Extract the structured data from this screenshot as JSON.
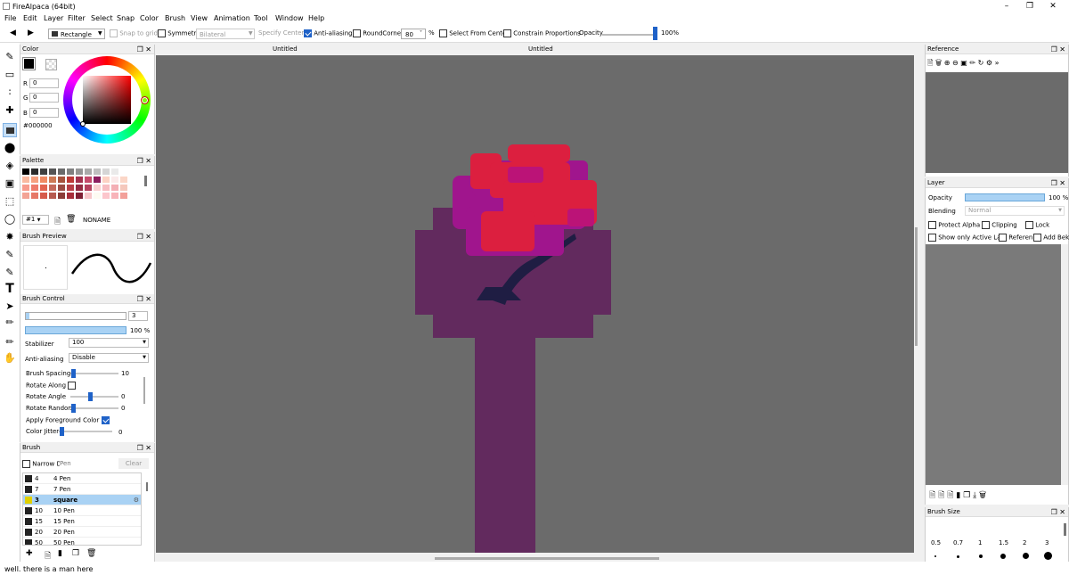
{
  "app": {
    "title": "FireAlpaca (64bit)"
  },
  "menu": [
    "File",
    "Edit",
    "Layer",
    "Filter",
    "Select",
    "Snap",
    "Color",
    "Brush",
    "View",
    "Animation",
    "Tool",
    "Window",
    "Help"
  ],
  "toolbar": {
    "tool_select": "Rectangle",
    "snap": "Snap to grid",
    "symmetry": "Symmetry",
    "symmetry_mode": "Bilateral",
    "specify_center": "Specify Center",
    "antialias": "Anti-aliasing",
    "roundcorner": "RoundCorner",
    "roundcorner_value": "80",
    "percent": "%",
    "select_center": "Select From Center",
    "constrain": "Constrain Proportions",
    "opacity": "Opacity",
    "opacity_value": "100%"
  },
  "docs": {
    "tab1": "Untitled",
    "tab2": "Untitled"
  },
  "color_panel": {
    "title": "Color",
    "r_label": "R",
    "r": "0",
    "g_label": "G",
    "g": "0",
    "b_label": "B",
    "b": "0",
    "hex": "#000000",
    "fg": "#000000"
  },
  "palette_panel": {
    "title": "Palette",
    "selector": "#1",
    "name": "NONAME",
    "rows": [
      [
        "#000000",
        "#2b2b2b",
        "#404040",
        "#555555",
        "#6a6a6a",
        "#808080",
        "#959595",
        "#aaaaaa",
        "#c0c0c0",
        "#d5d5d5",
        "#eaeaea",
        "#ffffff"
      ],
      [
        "#f9b9a0",
        "#f6a07f",
        "#f08a63",
        "#cd7a55",
        "#a6533d",
        "#bb3a36",
        "#a2304d",
        "#c44a6b",
        "#8c1d5e",
        "#fcd2c4",
        "#fbeaea",
        "#fbd6c7"
      ],
      [
        "#f79b8d",
        "#ee7b6b",
        "#e2634f",
        "#c46a5b",
        "#9b4b43",
        "#b73f47",
        "#932b42",
        "#b5405e",
        "#fad0d0",
        "#f7bcc1",
        "#f4aeb5",
        "#f5c8bc"
      ],
      [
        "#f3a395",
        "#e67867",
        "#d65a4b",
        "#b75b50",
        "#8b3d38",
        "#a62e3a",
        "#7e2034",
        "#f7c6c9",
        "#fdfbf2",
        "#fcc6cc",
        "#f8b3b9",
        "#f3a09a"
      ]
    ]
  },
  "brush_preview": {
    "title": "Brush Preview"
  },
  "brush_control": {
    "title": "Brush Control",
    "size": "3",
    "opacity": "100 %",
    "stabilizer_label": "Stabilizer",
    "stabilizer": "100",
    "antialias_label": "Anti-aliasing",
    "antialias": "Disable",
    "spacing_label": "Brush Spacing",
    "spacing": "10",
    "rotate_along": "Rotate Along",
    "rotate_angle_label": "Rotate Angle",
    "rotate_angle": "0",
    "rotate_random_label": "Rotate Random",
    "rotate_random": "0",
    "apply_fg": "Apply Foreground Color",
    "color_jitter_label": "Color Jitter",
    "color_jitter": "0"
  },
  "brush_panel": {
    "title": "Brush",
    "narrow": "Narrow D",
    "search_placeholder": "Pen",
    "clear": "Clear",
    "items": [
      {
        "num": "4",
        "label": "4 Pen"
      },
      {
        "num": "7",
        "label": "7 Pen"
      },
      {
        "num": "3",
        "label": "square"
      },
      {
        "num": "10",
        "label": "10 Pen"
      },
      {
        "num": "15",
        "label": "15 Pen"
      },
      {
        "num": "20",
        "label": "20 Pen"
      },
      {
        "num": "50",
        "label": "50 Pen"
      }
    ]
  },
  "reference_panel": {
    "title": "Reference"
  },
  "layer_panel": {
    "title": "Layer",
    "opacity_label": "Opacity",
    "opacity": "100 %",
    "blending_label": "Blending",
    "blending": "Normal",
    "protect_alpha": "Protect Alpha",
    "clipping": "Clipping",
    "lock": "Lock",
    "show_only": "Show only Active Lay",
    "reference": "Referen",
    "add_bek": "Add Bek"
  },
  "brush_size_panel": {
    "title": "Brush Size",
    "sizes": [
      "0.5",
      "0.7",
      "1",
      "1.5",
      "2",
      "3"
    ]
  },
  "status": {
    "text": "well. there is a man here"
  }
}
